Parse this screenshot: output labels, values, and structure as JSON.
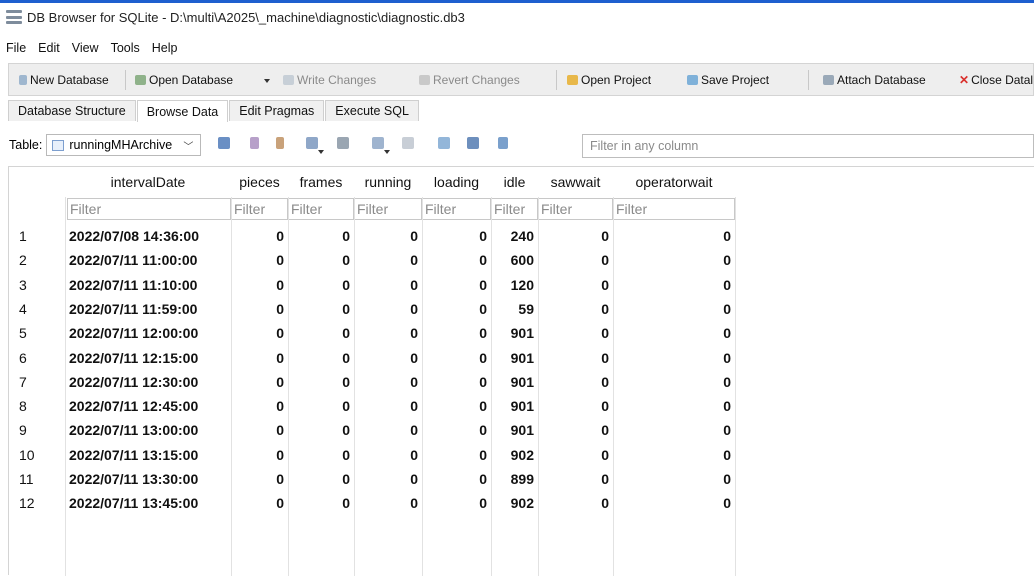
{
  "window": {
    "title": "DB Browser for SQLite - D:\\multi\\A2025\\_machine\\diagnostic\\diagnostic.db3"
  },
  "menu": [
    "File",
    "Edit",
    "View",
    "Tools",
    "Help"
  ],
  "toolbar": {
    "new_database": "New Database",
    "open_database": "Open Database",
    "write_changes": "Write Changes",
    "revert_changes": "Revert Changes",
    "open_project": "Open Project",
    "save_project": "Save Project",
    "attach_database": "Attach Database",
    "close_database": "Close Datal"
  },
  "tabs": [
    "Database Structure",
    "Browse Data",
    "Edit Pragmas",
    "Execute SQL"
  ],
  "active_tab": "Browse Data",
  "browse": {
    "table_label": "Table:",
    "table_name": "runningMHArchive",
    "filter_placeholder": "Filter in any column"
  },
  "columns": [
    "intervalDate",
    "pieces",
    "frames",
    "running",
    "loading",
    "idle",
    "sawwait",
    "operatorwait"
  ],
  "filter_placeholder": "Filter",
  "rows": [
    [
      "1",
      "2022/07/08 14:36:00",
      "0",
      "0",
      "0",
      "0",
      "240",
      "0",
      "0"
    ],
    [
      "2",
      "2022/07/11 11:00:00",
      "0",
      "0",
      "0",
      "0",
      "600",
      "0",
      "0"
    ],
    [
      "3",
      "2022/07/11 11:10:00",
      "0",
      "0",
      "0",
      "0",
      "120",
      "0",
      "0"
    ],
    [
      "4",
      "2022/07/11 11:59:00",
      "0",
      "0",
      "0",
      "0",
      "59",
      "0",
      "0"
    ],
    [
      "5",
      "2022/07/11 12:00:00",
      "0",
      "0",
      "0",
      "0",
      "901",
      "0",
      "0"
    ],
    [
      "6",
      "2022/07/11 12:15:00",
      "0",
      "0",
      "0",
      "0",
      "901",
      "0",
      "0"
    ],
    [
      "7",
      "2022/07/11 12:30:00",
      "0",
      "0",
      "0",
      "0",
      "901",
      "0",
      "0"
    ],
    [
      "8",
      "2022/07/11 12:45:00",
      "0",
      "0",
      "0",
      "0",
      "901",
      "0",
      "0"
    ],
    [
      "9",
      "2022/07/11 13:00:00",
      "0",
      "0",
      "0",
      "0",
      "901",
      "0",
      "0"
    ],
    [
      "10",
      "2022/07/11 13:15:00",
      "0",
      "0",
      "0",
      "0",
      "902",
      "0",
      "0"
    ],
    [
      "11",
      "2022/07/11 13:30:00",
      "0",
      "0",
      "0",
      "0",
      "899",
      "0",
      "0"
    ],
    [
      "12",
      "2022/07/11 13:45:00",
      "0",
      "0",
      "0",
      "0",
      "902",
      "0",
      "0"
    ]
  ],
  "colors": {
    "accent": "#1e5fcf",
    "close_x": "#d9302c",
    "open_folder": "#e8b84a"
  }
}
